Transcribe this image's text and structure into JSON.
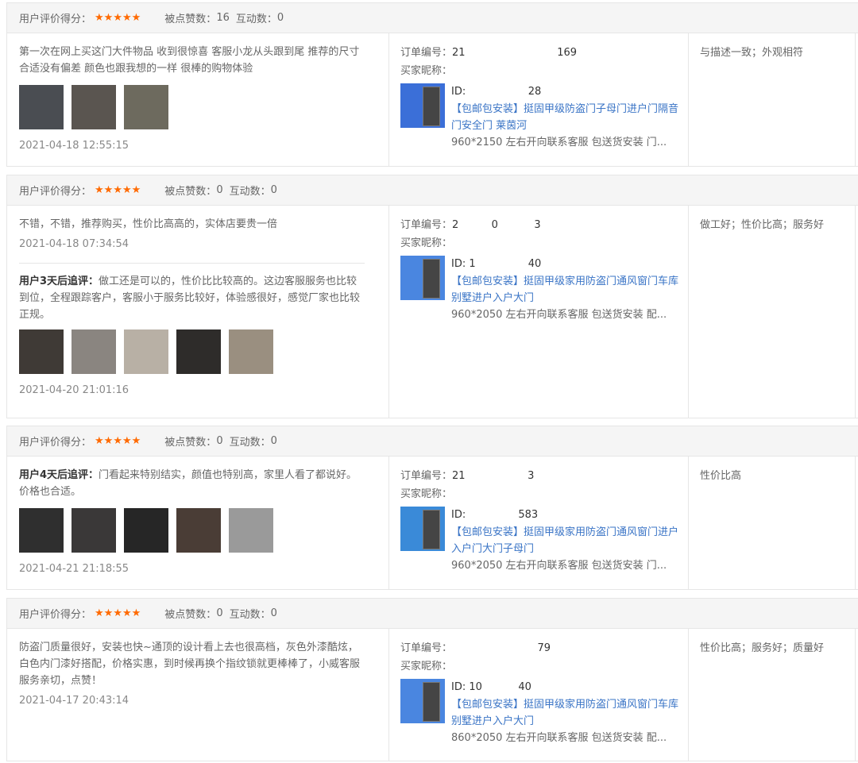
{
  "labels": {
    "score": "用户评价得分：",
    "likes": "被点赞数：",
    "interactions": "互动数：",
    "order_no": "订单编号：",
    "buyer": "买家昵称："
  },
  "reviews": [
    {
      "likes": "16",
      "interactions": "0",
      "text": "第一次在网上买这门大件物品 收到很惊喜 客服小龙从头跟到尾 推荐的尺寸合适没有偏差 颜色也跟我想的一样 很棒的购物体验",
      "date": "2021-04-18 12:55:15",
      "thumb_colors": [
        "#4a4d52",
        "#5a5550",
        "#6d6a5e"
      ],
      "order_no": "21                            169",
      "buyer": "",
      "product_id": "ID:                   28",
      "product_title": "【包邮包安装】挺固甲级防盗门子母门进户门隔音门安全门 莱茵河",
      "product_spec": "960*2150 左右开向联系客服 包送货安装 门...",
      "tags": "与描述一致；外观相符"
    },
    {
      "likes": "0",
      "interactions": "0",
      "text": "不错，不错，推荐购买，性价比高高的，实体店要贵一倍",
      "date": "2021-04-18 07:34:54",
      "followup_label": "用户3天后追评：",
      "followup_text": "做工还是可以的，性价比比较高的。这边客服服务也比较到位，全程跟踪客户，客服小于服务比较好，体验感很好，感觉厂家也比较正规。",
      "followup_date": "2021-04-20 21:01:16",
      "thumb_colors": [
        "#3f3a36",
        "#8a8580",
        "#b8b0a5",
        "#2e2c2a",
        "#9a8f80"
      ],
      "order_no": "2          0           3",
      "buyer": "",
      "product_id": "ID: 1                40",
      "product_title": "【包邮包安装】挺固甲级家用防盗门通风窗门车库别墅进户入户大门",
      "product_spec": "960*2050 左右开向联系客服 包送货安装 配...",
      "tags": "做工好；性价比高；服务好"
    },
    {
      "likes": "0",
      "interactions": "0",
      "followup_label": "用户4天后追评：",
      "followup_text": "门看起来特别结实，颜值也特别高，家里人看了都说好。价格也合适。",
      "date": "2021-04-21 21:18:55",
      "thumb_colors": [
        "#2f2f2f",
        "#3a3838",
        "#262626",
        "#4a3d36",
        "#9a9a9a"
      ],
      "order_no": "21                   3",
      "buyer": "",
      "product_id": "ID:                583",
      "product_title": "【包邮包安装】挺固甲级家用防盗门通风窗门进户入户门大门子母门",
      "product_spec": "960*2050 左右开向联系客服 包送货安装 门...",
      "tags": "性价比高"
    },
    {
      "likes": "0",
      "interactions": "0",
      "text": "防盗门质量很好，安装也快~通顶的设计看上去也很高档，灰色外漆酷炫，白色内门漆好搭配，价格实惠，到时候再换个指纹锁就更棒棒了，小威客服服务亲切，点赞！",
      "date": "2021-04-17 20:43:14",
      "order_no": "                          79",
      "buyer": "",
      "product_id": "ID: 10           40",
      "product_title": "【包邮包安装】挺固甲级家用防盗门通风窗门车库别墅进户入户大门",
      "product_spec": "860*2050 左右开向联系客服 包送货安装 配...",
      "tags": "性价比高；服务好；质量好"
    }
  ],
  "colors": {
    "star": "#ff6a00",
    "link": "#3a74c6",
    "border": "#e6e6e6",
    "header_bg": "#f5f5f5"
  },
  "icons": {
    "star": "star-icon"
  }
}
